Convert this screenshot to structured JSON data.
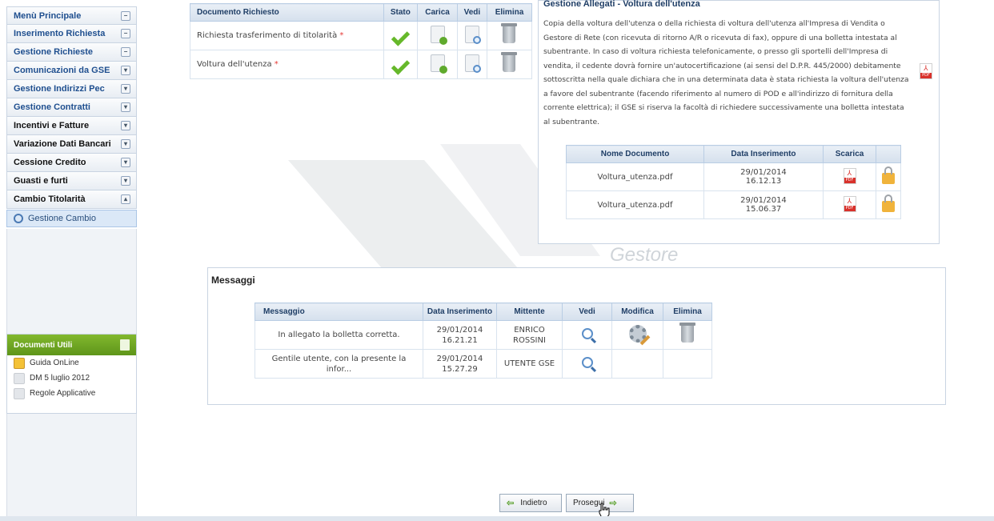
{
  "sidebar": {
    "items": [
      {
        "label": "Menù Principale",
        "toggle": "−"
      },
      {
        "label": "Inserimento Richiesta",
        "toggle": "−"
      },
      {
        "label": "Gestione Richieste",
        "toggle": "−"
      },
      {
        "label": "Comunicazioni da GSE",
        "toggle": "▾"
      },
      {
        "label": "Gestione Indirizzi Pec",
        "toggle": "▾"
      },
      {
        "label": "Gestione Contratti",
        "toggle": "▾"
      },
      {
        "label": "Incentivi e Fatture",
        "toggle": "▾"
      },
      {
        "label": "Variazione Dati Bancari",
        "toggle": "▾"
      },
      {
        "label": "Cessione Credito",
        "toggle": "▾"
      },
      {
        "label": "Guasti e furti",
        "toggle": "▾"
      },
      {
        "label": "Cambio Titolarità",
        "toggle": "▴"
      }
    ],
    "subitem": "Gestione Cambio"
  },
  "documenti_utili": {
    "title": "Documenti Utili",
    "items": [
      "Guida OnLine",
      "DM 5 luglio 2012",
      "Regole Applicative"
    ]
  },
  "doc_table": {
    "headers": [
      "Documento Richiesto",
      "Stato",
      "Carica",
      "Vedi",
      "Elimina"
    ],
    "rows": [
      {
        "name": "Richiesta trasferimento di titolarità",
        "required": "*"
      },
      {
        "name": "Voltura dell'utenza",
        "required": "*"
      }
    ]
  },
  "allegati": {
    "title": "Gestione Allegati - Voltura dell'utenza",
    "description": "Copia della voltura dell'utenza o della richiesta di voltura dell'utenza all'Impresa di Vendita o Gestore di Rete (con ricevuta di ritorno A/R o ricevuta di fax), oppure di una bolletta intestata al subentrante. In caso di voltura richiesta telefonicamente, o presso gli sportelli dell'Impresa di vendita, il cedente dovrà fornire un'autocertificazione (ai sensi del D.P.R. 445/2000) debitamente sottoscritta nella quale dichiara che in una determinata data è stata richiesta la voltura dell'utenza a favore del subentrante (facendo riferimento al numero di POD e all'indirizzo di fornitura della corrente elettrica); il GSE si riserva la facoltà di richiedere successivamente una bolletta intestata al subentrante.",
    "pdf_label": "PDF",
    "headers": [
      "Nome Documento",
      "Data Inserimento",
      "Scarica",
      ""
    ],
    "rows": [
      {
        "name": "Voltura_utenza.pdf",
        "date": "29/01/2014",
        "time": "16.12.13"
      },
      {
        "name": "Voltura_utenza.pdf",
        "date": "29/01/2014",
        "time": "15.06.37"
      }
    ]
  },
  "watermark": {
    "text": "Gestore"
  },
  "messaggi": {
    "title": "Messaggi",
    "headers": [
      "Messaggio",
      "Data Inserimento",
      "Mittente",
      "Vedi",
      "Modifica",
      "Elimina"
    ],
    "rows": [
      {
        "message": "In allegato la bolletta corretta.",
        "date": "29/01/2014",
        "time": "16.21.21",
        "sender_line1": "ENRICO",
        "sender_line2": "ROSSINI"
      },
      {
        "message_line1": "Gentile utente, con la presente la",
        "message_line2": "infor...",
        "date": "29/01/2014",
        "time": "15.27.29",
        "sender": "UTENTE GSE"
      }
    ]
  },
  "buttons": {
    "back": "Indietro",
    "next": "Prosegui"
  },
  "colors": {
    "accent": "#1f4f8f",
    "green": "#66b82a",
    "header_bg": "#d5e0ed",
    "docs_header": "#6ea323",
    "pdf_red": "#d9312b"
  }
}
